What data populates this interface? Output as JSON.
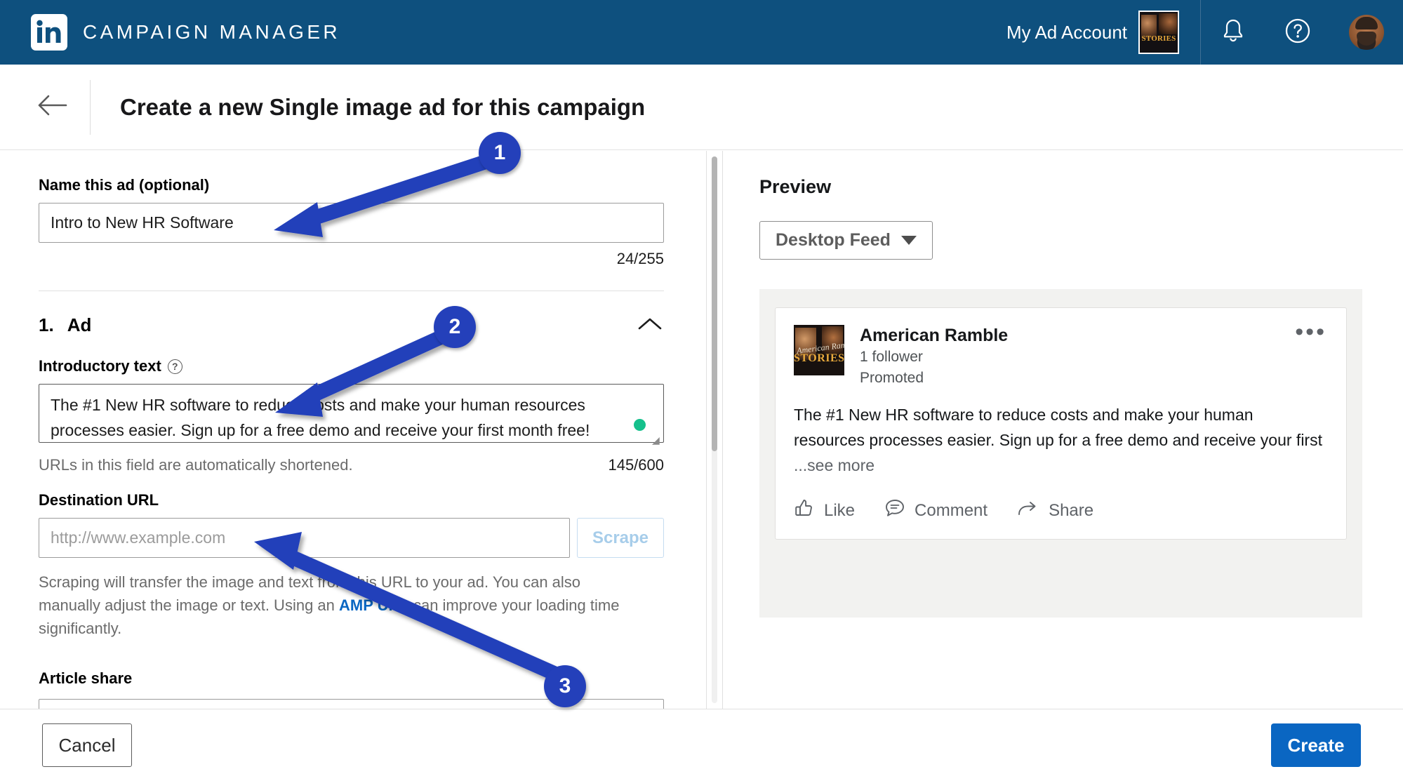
{
  "topnav": {
    "brand": "CAMPAIGN MANAGER",
    "logo_icon": "linkedin-logo-icon",
    "account_label": "My Ad Account",
    "account_thumb_text": "STORIES",
    "notifications_icon": "bell-icon",
    "help_icon": "question-circle-icon",
    "avatar_icon": "user-avatar"
  },
  "page_header": {
    "back_icon": "arrow-left-icon",
    "title": "Create a new Single image ad for this campaign"
  },
  "form": {
    "name_label": "Name this ad (optional)",
    "name_value": "Intro to New HR Software",
    "name_placeholder": "",
    "name_counter": "24/255",
    "section": {
      "number": "1.",
      "title": "Ad",
      "collapse_icon": "chevron-up-icon"
    },
    "intro_label": "Introductory text",
    "intro_help_icon": "help-circle-icon",
    "intro_value": "The #1 New HR software to reduce costs and make your human resources processes easier. Sign up for a free demo and receive your first month free!",
    "intro_helper": "URLs in this field are automatically shortened.",
    "intro_counter": "145/600",
    "grammar_indicator": "green-status-dot",
    "url_label": "Destination URL",
    "url_placeholder": "http://www.example.com",
    "url_value": "",
    "scrape_label": "Scrape",
    "scrape_note_part1": "Scraping will transfer the image and text from this URL to your ad. You can also manually adjust the image or text. Using an ",
    "scrape_note_link": "AMP URL",
    "scrape_note_part2": " can improve your loading time significantly.",
    "article_share_label": "Article share"
  },
  "preview": {
    "title": "Preview",
    "format_button": "Desktop Feed",
    "format_caret_icon": "caret-down-icon",
    "ad": {
      "logo_script": "American Ramble",
      "logo_text": "STORIES",
      "company": "American Ramble",
      "followers": "1 follower",
      "promoted": "Promoted",
      "overflow_icon": "ellipsis-icon",
      "body": "The #1 New HR software to reduce costs and make your human resources processes easier. Sign up for a free demo and receive your first ",
      "see_more": "...see more",
      "actions": [
        {
          "label": "Like",
          "icon": "thumbs-up-icon"
        },
        {
          "label": "Comment",
          "icon": "comment-bubble-icon"
        },
        {
          "label": "Share",
          "icon": "share-arrow-icon"
        }
      ]
    }
  },
  "footer": {
    "cancel_label": "Cancel",
    "create_label": "Create"
  },
  "annotations": [
    {
      "number": "1"
    },
    {
      "number": "2"
    },
    {
      "number": "3"
    }
  ],
  "colors": {
    "nav_blue": "#0e507e",
    "annotation_blue": "#2440ba",
    "primary_button": "#0a66c2",
    "link_blue": "#0a66c2",
    "grammar_green": "#15c08c"
  }
}
